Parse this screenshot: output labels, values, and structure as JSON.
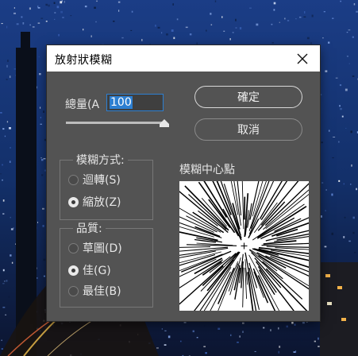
{
  "dialog": {
    "title": "放射狀模糊",
    "close_icon": "close-icon"
  },
  "amount": {
    "label": "總量(A",
    "value": "100",
    "slider_value": 100,
    "slider_max": 100
  },
  "buttons": {
    "ok": "確定",
    "cancel": "取消"
  },
  "blur_method": {
    "legend": "模糊方式:",
    "options": [
      {
        "label": "迴轉(S)",
        "checked": false
      },
      {
        "label": "縮放(Z)",
        "checked": true
      }
    ]
  },
  "quality": {
    "legend": "品質:",
    "options": [
      {
        "label": "草圖(D)",
        "checked": false
      },
      {
        "label": "佳(G)",
        "checked": true
      },
      {
        "label": "最佳(B)",
        "checked": false
      }
    ]
  },
  "blur_center": {
    "label": "模糊中心點"
  },
  "colors": {
    "dialog_bg": "#535353",
    "input_border": "#2d7fd1",
    "text": "#e6e6e6"
  }
}
